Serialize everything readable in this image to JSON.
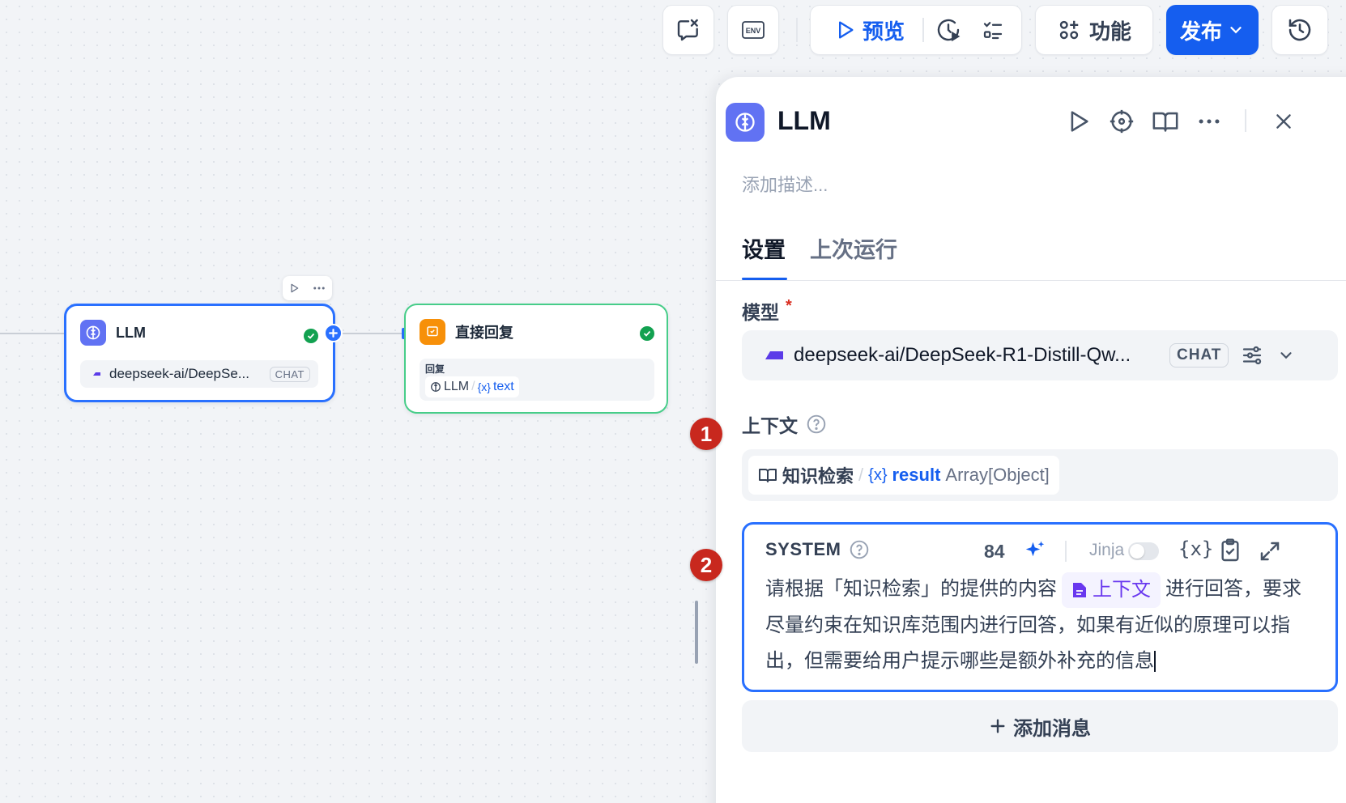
{
  "toolbar": {
    "preview_label": "预览",
    "features_label": "功能",
    "publish_label": "发布"
  },
  "canvas": {
    "llm_node": {
      "title": "LLM",
      "model": "deepseek-ai/DeepSe...",
      "mode": "CHAT"
    },
    "reply_node": {
      "title": "直接回复",
      "field_label": "回复",
      "source_node": "LLM",
      "variable": "text"
    }
  },
  "panel": {
    "title": "LLM",
    "description_placeholder": "添加描述...",
    "tabs": [
      "设置",
      "上次运行"
    ],
    "model_section": {
      "label": "模型",
      "required_mark": "*",
      "model_name": "deepseek-ai/DeepSeek-R1-Distill-Qw...",
      "mode": "CHAT"
    },
    "context_section": {
      "label": "上下文",
      "source_node": "知识检索",
      "separator": "/",
      "variable": "result",
      "type": "Array[Object]"
    },
    "system_prompt": {
      "role": "SYSTEM",
      "token_count": "84",
      "jinja_label": "Jinja",
      "text_before": "请根据「知识检索」的提供的内容",
      "context_chip": "上下文",
      "text_after": "进行回答，要求尽量约束在知识库范围内进行回答，如果有近似的原理可以指出，但需要给用户提示哪些是额外补充的信息"
    },
    "add_message_label": "添加消息"
  },
  "annotations": [
    "1",
    "2"
  ],
  "colors": {
    "accent": "#155eef",
    "publish_bg": "#155eef",
    "node_selected_border": "#2970ff",
    "node_success_border": "#47cd89",
    "badge": "#c8281e",
    "llm_icon_bg": "#6172f3",
    "reply_icon_bg": "#f79009"
  }
}
